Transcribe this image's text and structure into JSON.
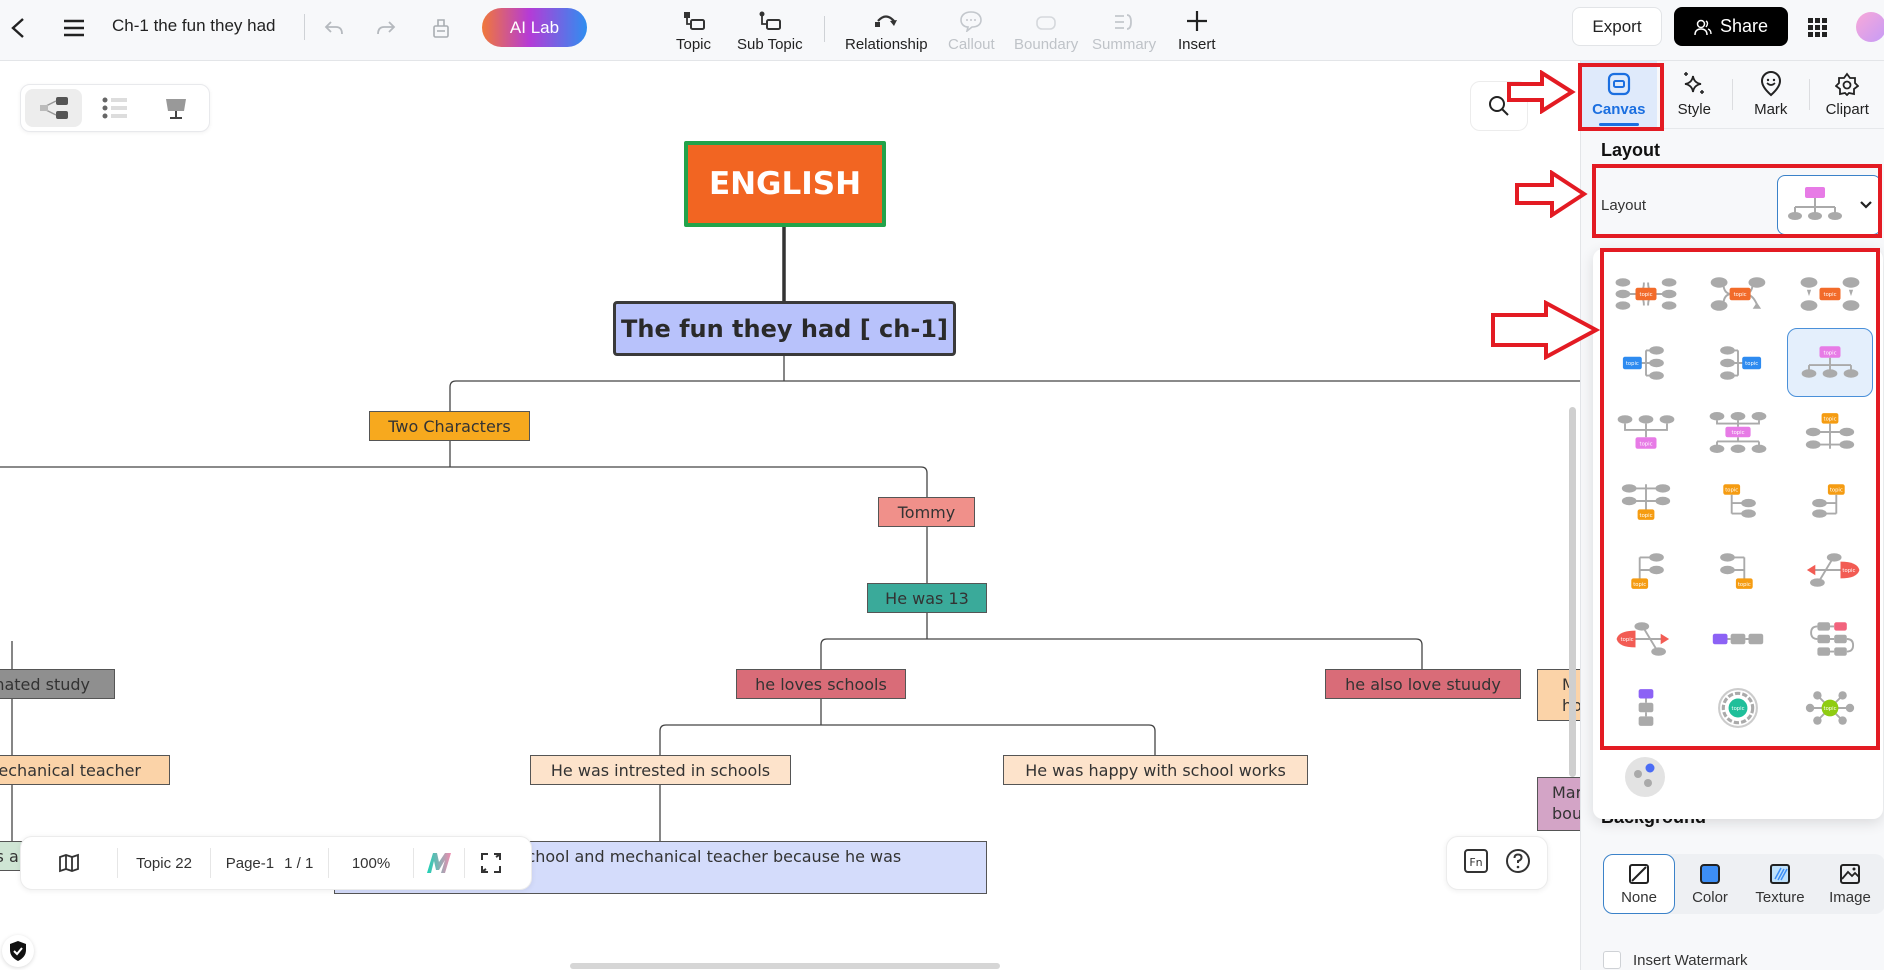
{
  "header": {
    "doc_title": "Ch-1 the fun they had",
    "ai_lab_label": "AI Lab",
    "tools": [
      {
        "label": "Topic",
        "icon": "topic-icon",
        "enabled": true
      },
      {
        "label": "Sub Topic",
        "icon": "subtopic-icon",
        "enabled": true
      },
      {
        "label": "Relationship",
        "icon": "relationship-icon",
        "enabled": true
      },
      {
        "label": "Callout",
        "icon": "callout-icon",
        "enabled": false
      },
      {
        "label": "Boundary",
        "icon": "boundary-icon",
        "enabled": false
      },
      {
        "label": "Summary",
        "icon": "summary-icon",
        "enabled": false
      },
      {
        "label": "Insert",
        "icon": "plus-icon",
        "enabled": true
      }
    ],
    "export_label": "Export",
    "share_label": "Share"
  },
  "view_switch": {
    "options": [
      "mind-map-view",
      "outline-view",
      "presentation-view"
    ],
    "active": "mind-map-view"
  },
  "mindmap": {
    "root": {
      "text": "ENGLISH",
      "fill": "#f26522",
      "border": "#22a34a",
      "text_color": "#ffffff"
    },
    "main": {
      "text": "The fun they had [ ch-1]",
      "fill": "#b8c2fb",
      "border": "#3a3a3a"
    },
    "nodes": [
      {
        "id": "two-characters",
        "text": "Two Characters",
        "fill": "#f7a91e"
      },
      {
        "id": "tommy",
        "text": "Tommy",
        "fill": "#f0908a"
      },
      {
        "id": "he-was-13",
        "text": "He was 13",
        "fill": "#3aaa9a"
      },
      {
        "id": "hated-study",
        "text": "hated study",
        "fill": "#8f8f8f"
      },
      {
        "id": "mechanical-teacher",
        "text": "mechanical teacher",
        "fill": "#fbd3a8"
      },
      {
        "id": "schools-teacher",
        "text": "ols and with her mechanical teacher",
        "fill": "#cfe5d4"
      },
      {
        "id": "he-loves-schools",
        "text": "he loves schools",
        "fill": "#d96c78"
      },
      {
        "id": "he-also-love-stuudy",
        "text": "he also love stuudy",
        "fill": "#d96c78"
      },
      {
        "id": "intrested-in-schools",
        "text": "He was intrested in schools",
        "fill": "#fde3cb"
      },
      {
        "id": "happy-school-works",
        "text": "He was happy with school works",
        "fill": "#fde3cb"
      },
      {
        "id": "happy-school-teacher",
        "text": "He was happy with school and mechanical teacher because he was regular in schools",
        "fill": "#d4dcfb"
      },
      {
        "id": "m-ho",
        "text": "M ho",
        "fill": "#fbd3a8"
      },
      {
        "id": "mar-bou",
        "text": "Mar bou",
        "fill": "#d3a4c6"
      }
    ]
  },
  "bottom_bar": {
    "topic_count": "Topic 22",
    "page_label": "Page-1",
    "page_count": "1 / 1",
    "zoom": "100%"
  },
  "panel": {
    "tabs": [
      {
        "label": "Canvas",
        "active": true
      },
      {
        "label": "Style",
        "active": false
      },
      {
        "label": "Mark",
        "active": false
      },
      {
        "label": "Clipart",
        "active": false
      }
    ],
    "layout_section_title": "Layout",
    "layout_label": "Layout",
    "layout_selected": "org-chart-down",
    "layout_options": [
      "mind-map-both",
      "mind-map-right-arrow",
      "mind-map-down-arrows",
      "logic-right",
      "logic-left",
      "org-chart-down",
      "org-chart-up",
      "org-chart-both",
      "tree-right-down",
      "tree-both",
      "tree-right",
      "tree-left",
      "tree-up-right",
      "tree-up-left",
      "fishbone-right",
      "fishbone-left",
      "timeline-horizontal",
      "timeline-snake",
      "timeline-vertical",
      "circle-map",
      "bubble-map"
    ],
    "layout_topic_label": "topic",
    "background_title": "Background",
    "background_options": [
      {
        "label": "None",
        "active": true
      },
      {
        "label": "Color",
        "active": false
      },
      {
        "label": "Texture",
        "active": false
      },
      {
        "label": "Image",
        "active": false
      }
    ],
    "insert_watermark_label": "Insert Watermark",
    "insert_watermark_checked": false
  },
  "annotations": {
    "highlight_color": "#e31b23"
  }
}
